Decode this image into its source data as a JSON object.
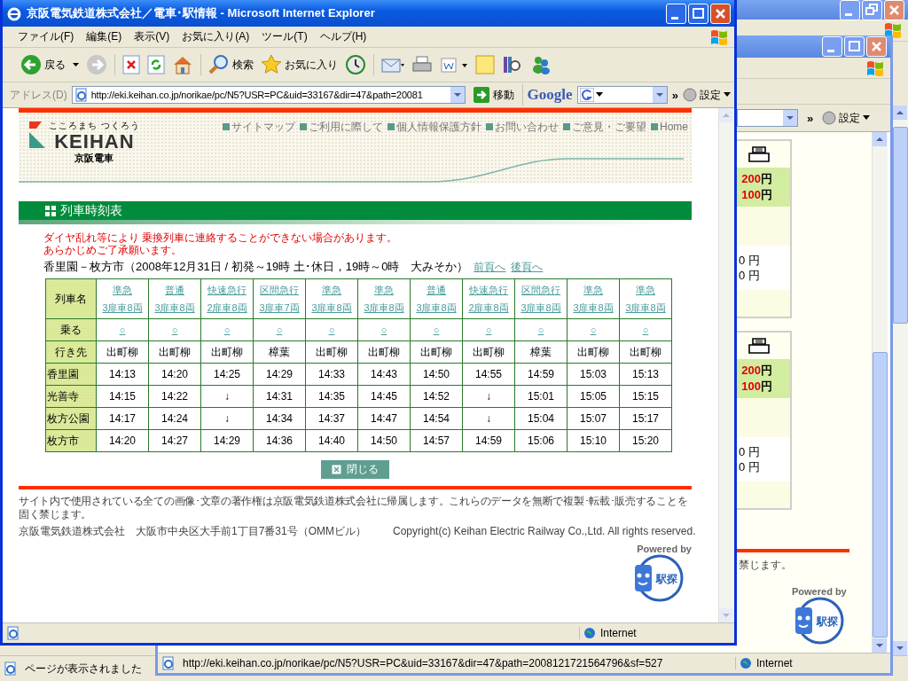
{
  "desktop_window": {
    "status_text": "ページが表示されました"
  },
  "second_window": {
    "search_more": "»",
    "settings_menu": "設定",
    "fare_cards": [
      {
        "fares": [
          {
            "amount": "200",
            "unit": "円"
          },
          {
            "amount": "100",
            "unit": "円"
          }
        ],
        "partial_fares": [
          "0 円",
          "0 円"
        ]
      },
      {
        "fares": [
          {
            "amount": "200",
            "unit": "円"
          },
          {
            "amount": "100",
            "unit": "円"
          }
        ],
        "partial_fares": [
          "0 円",
          "0 円"
        ]
      }
    ],
    "footer_tail": "禁じます。",
    "powered_by": "Powered by",
    "logo_text": "駅探",
    "status_url": "http://eki.keihan.co.jp/norikae/pc/N5?USR=PC&uid=33167&dir=47&path=2008121721564796&sf=527",
    "status_zone": "Internet"
  },
  "window": {
    "title": "京阪電気鉄道株式会社／電車･駅情報 - Microsoft Internet Explorer",
    "menu": [
      "ファイル(F)",
      "編集(E)",
      "表示(V)",
      "お気に入り(A)",
      "ツール(T)",
      "ヘルプ(H)"
    ],
    "toolbar": {
      "back": "戻る",
      "search": "検索",
      "favorites": "お気に入り"
    },
    "address": {
      "label": "アドレス(D)",
      "url": "http://eki.keihan.co.jp/norikae/pc/N5?USR=PC&uid=33167&dir=47&path=20081",
      "go": "移動"
    },
    "google_bar": {
      "brand": "Google",
      "more": "»",
      "settings": "設定"
    },
    "status_zone": "Internet"
  },
  "page": {
    "logo": {
      "tagline": "こころまち つくろう",
      "name": "KEIHAN",
      "sub": "京阪電車"
    },
    "header_links": [
      "サイトマップ",
      "ご利用に際して",
      "個人情報保護方針",
      "お問い合わせ",
      "ご意見・ご要望",
      "Home"
    ],
    "section_title": "列車時刻表",
    "notice": [
      "ダイヤ乱れ等により 乗換列車に連絡することができない場合があります。",
      "あらかじめご了承願います。"
    ],
    "route_title": "香里園－枚方市（2008年12月31日 / 初発～19時 土･休日，19時～0時　大みそか）",
    "page_links": [
      "前頁へ",
      "後頁へ"
    ],
    "timetable": {
      "row_labels": [
        "列車名",
        "乗る",
        "行き先"
      ],
      "trains": [
        {
          "type": "準急",
          "cars": "3扉車8両",
          "board": "○",
          "destination": "出町柳"
        },
        {
          "type": "普通",
          "cars": "3扉車8両",
          "board": "○",
          "destination": "出町柳"
        },
        {
          "type": "快速急行",
          "cars": "2扉車8両",
          "board": "○",
          "destination": "出町柳"
        },
        {
          "type": "区間急行",
          "cars": "3扉車7両",
          "board": "○",
          "destination": "樟葉"
        },
        {
          "type": "準急",
          "cars": "3扉車8両",
          "board": "○",
          "destination": "出町柳"
        },
        {
          "type": "準急",
          "cars": "3扉車8両",
          "board": "○",
          "destination": "出町柳"
        },
        {
          "type": "普通",
          "cars": "3扉車8両",
          "board": "○",
          "destination": "出町柳"
        },
        {
          "type": "快速急行",
          "cars": "2扉車8両",
          "board": "○",
          "destination": "出町柳"
        },
        {
          "type": "区間急行",
          "cars": "3扉車8両",
          "board": "○",
          "destination": "樟葉"
        },
        {
          "type": "準急",
          "cars": "3扉車8両",
          "board": "○",
          "destination": "出町柳"
        },
        {
          "type": "準急",
          "cars": "3扉車8両",
          "board": "○",
          "destination": "出町柳"
        }
      ],
      "stations": [
        {
          "name": "香里園",
          "times": [
            "14:13",
            "14:20",
            "14:25",
            "14:29",
            "14:33",
            "14:43",
            "14:50",
            "14:55",
            "14:59",
            "15:03",
            "15:13"
          ]
        },
        {
          "name": "光善寺",
          "times": [
            "14:15",
            "14:22",
            "↓",
            "14:31",
            "14:35",
            "14:45",
            "14:52",
            "↓",
            "15:01",
            "15:05",
            "15:15"
          ]
        },
        {
          "name": "枚方公園",
          "times": [
            "14:17",
            "14:24",
            "↓",
            "14:34",
            "14:37",
            "14:47",
            "14:54",
            "↓",
            "15:04",
            "15:07",
            "15:17"
          ]
        },
        {
          "name": "枚方市",
          "times": [
            "14:20",
            "14:27",
            "14:29",
            "14:36",
            "14:40",
            "14:50",
            "14:57",
            "14:59",
            "15:06",
            "15:10",
            "15:20"
          ]
        }
      ]
    },
    "close_button": "閉じる",
    "copyright_notice": "サイト内で使用されている全ての画像･文章の著作権は京阪電気鉄道株式会社に帰属します。これらのデータを無断で複製･転載･販売することを固く禁じます。",
    "company_address": "京阪電気鉄道株式会社　大阪市中央区大手前1丁目7番31号（OMMビル）",
    "copyright": "Copyright(c) Keihan Electric Railway Co.,Ltd. All rights reserved.",
    "powered_by": "Powered by",
    "logo_text": "駅探"
  }
}
